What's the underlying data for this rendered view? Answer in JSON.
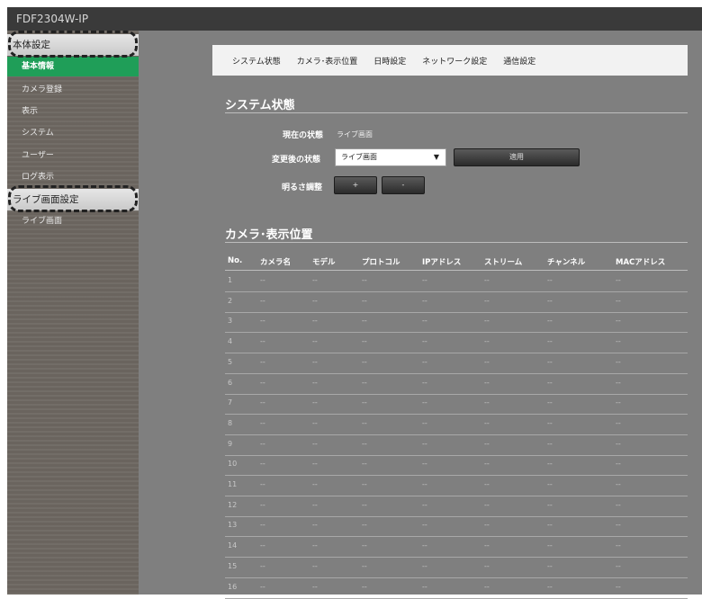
{
  "app": {
    "title": "FDF2304W-IP"
  },
  "sidebar": {
    "groups": [
      {
        "label": "本体設定"
      },
      {
        "label": "ライブ画面設定"
      }
    ],
    "items": [
      {
        "label": "基本情報"
      },
      {
        "label": "カメラ登録"
      },
      {
        "label": "表示"
      },
      {
        "label": "システム"
      },
      {
        "label": "ユーザー"
      },
      {
        "label": "ログ表示"
      },
      {
        "label": "ライブ画面"
      }
    ]
  },
  "tabs": [
    {
      "label": "システム状態"
    },
    {
      "label": "カメラ･表示位置"
    },
    {
      "label": "日時設定"
    },
    {
      "label": "ネットワーク設定"
    },
    {
      "label": "通信設定"
    }
  ],
  "system_status": {
    "title": "システム状態",
    "current_label": "現在の状態",
    "current_value": "ライブ画面",
    "after_label": "変更後の状態",
    "after_value": "ライブ画面",
    "apply_label": "適用",
    "brightness_label": "明るさ調整",
    "plus_label": "+",
    "minus_label": "-"
  },
  "camera_position": {
    "title": "カメラ･表示位置",
    "columns": [
      "No.",
      "カメラ名",
      "モデル",
      "プロトコル",
      "IPアドレス",
      "ストリーム",
      "チャンネル",
      "MACアドレス"
    ],
    "rows": [
      [
        "1",
        "--",
        "--",
        "--",
        "--",
        "--",
        "--",
        "--"
      ],
      [
        "2",
        "--",
        "--",
        "--",
        "--",
        "--",
        "--",
        "--"
      ],
      [
        "3",
        "--",
        "--",
        "--",
        "--",
        "--",
        "--",
        "--"
      ],
      [
        "4",
        "--",
        "--",
        "--",
        "--",
        "--",
        "--",
        "--"
      ],
      [
        "5",
        "--",
        "--",
        "--",
        "--",
        "--",
        "--",
        "--"
      ],
      [
        "6",
        "--",
        "--",
        "--",
        "--",
        "--",
        "--",
        "--"
      ],
      [
        "7",
        "--",
        "--",
        "--",
        "--",
        "--",
        "--",
        "--"
      ],
      [
        "8",
        "--",
        "--",
        "--",
        "--",
        "--",
        "--",
        "--"
      ],
      [
        "9",
        "--",
        "--",
        "--",
        "--",
        "--",
        "--",
        "--"
      ],
      [
        "10",
        "--",
        "--",
        "--",
        "--",
        "--",
        "--",
        "--"
      ],
      [
        "11",
        "--",
        "--",
        "--",
        "--",
        "--",
        "--",
        "--"
      ],
      [
        "12",
        "--",
        "--",
        "--",
        "--",
        "--",
        "--",
        "--"
      ],
      [
        "13",
        "--",
        "--",
        "--",
        "--",
        "--",
        "--",
        "--"
      ],
      [
        "14",
        "--",
        "--",
        "--",
        "--",
        "--",
        "--",
        "--"
      ],
      [
        "15",
        "--",
        "--",
        "--",
        "--",
        "--",
        "--",
        "--"
      ],
      [
        "16",
        "--",
        "--",
        "--",
        "--",
        "--",
        "--",
        "--"
      ]
    ]
  },
  "colors": {
    "sidebar_active": "#1f9e58",
    "main_bg": "#7f7f7f",
    "titlebar_bg": "#3a3a3a"
  }
}
